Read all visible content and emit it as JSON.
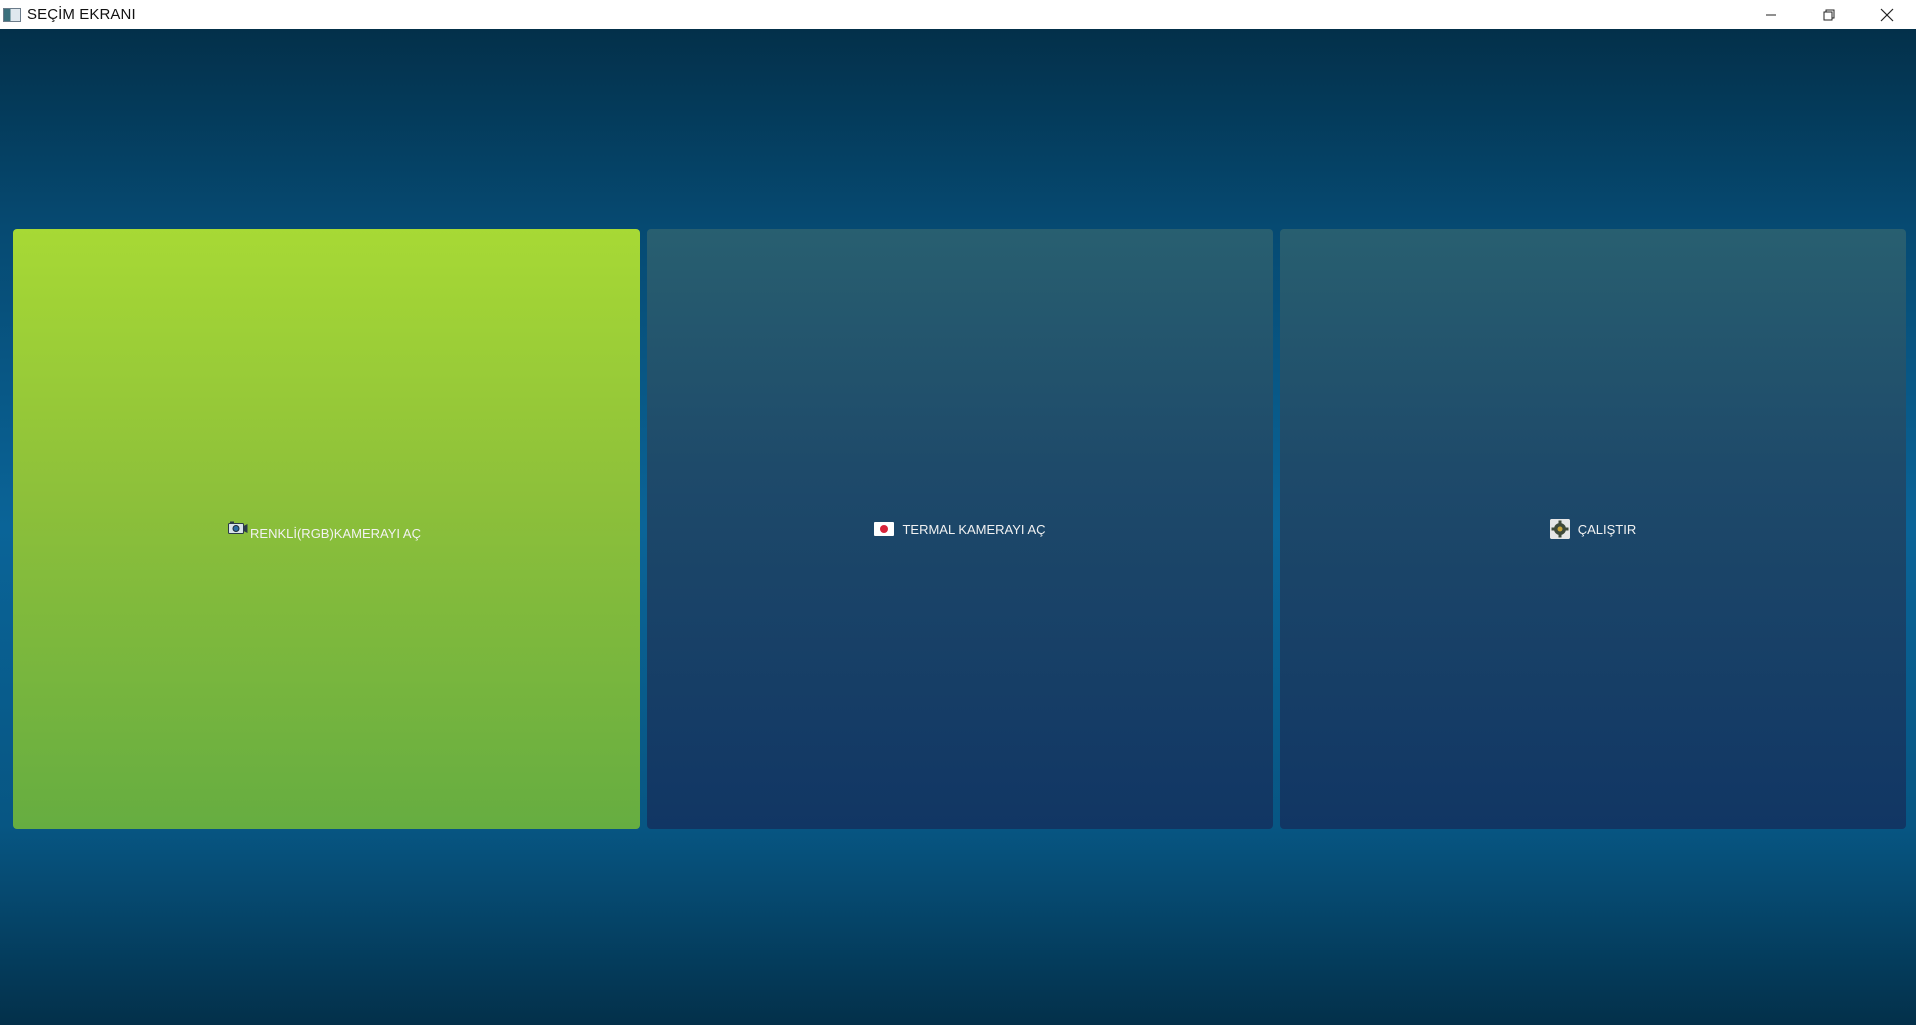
{
  "window": {
    "title": "SEÇİM EKRANI",
    "controls": {
      "minimize_icon": "minimize-icon",
      "maximize_icon": "restore-icon",
      "close_icon": "close-icon"
    }
  },
  "tiles": [
    {
      "label": "RENKLİ(RGB)KAMERAYI AÇ",
      "icon": "camera-icon",
      "color": "#8dc03a",
      "state": "highlighted"
    },
    {
      "label": "TERMAL KAMERAYI AÇ",
      "icon": "thermal-camera-icon",
      "color": "#1e4a6a"
    },
    {
      "label": "ÇALIŞTIR",
      "icon": "gear-icon",
      "color": "#1e4a6a"
    }
  ],
  "colors": {
    "background_top": "#03304a",
    "background_mid": "#0a6498",
    "accent_green": "#8dc03a",
    "tile_blue": "#1e4a6a"
  }
}
